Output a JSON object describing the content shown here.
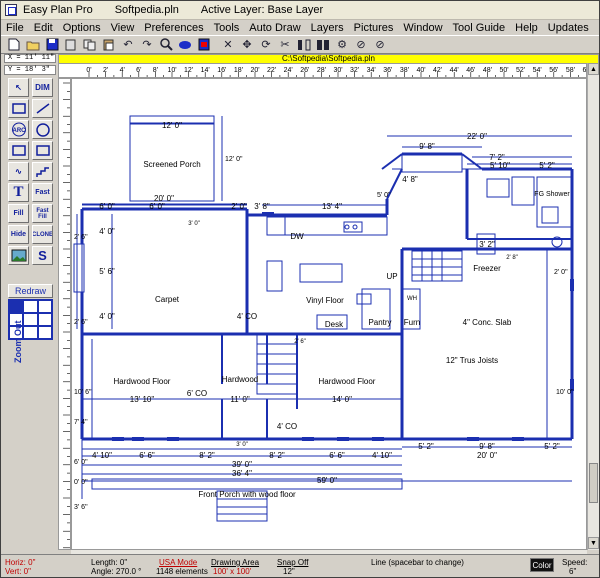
{
  "window": {
    "app": "Easy Plan Pro",
    "file": "Softpedia.pln",
    "active_layer": "Active Layer: Base Layer"
  },
  "menu": [
    "File",
    "Edit",
    "Options",
    "View",
    "Preferences",
    "Tools",
    "Auto Draw",
    "Layers",
    "Pictures",
    "Window",
    "Tool Guide",
    "Help",
    "Updates"
  ],
  "toolbar": {
    "icons": [
      "new-file-icon",
      "open-folder-icon",
      "save-icon",
      "print-preview-icon",
      "copy-icon",
      "paste-icon",
      "undo-icon",
      "redo-icon",
      "magnifier-icon",
      "toggle-icon",
      "color-fill-icon",
      "delete-icon",
      "move-icon",
      "rotate-icon",
      "cut-icon",
      "mirror-icon",
      "align-icon",
      "measure-icon",
      "check-icon",
      "no-icon"
    ]
  },
  "coords": {
    "x": "X = 11' 11\"",
    "y": "Y = 18' 3\""
  },
  "file_path": "C:\\Softpedia\\Softpedia.pln",
  "ruler_labels": [
    "0'",
    "2'",
    "4'",
    "6'",
    "8'",
    "10'",
    "12'",
    "14'",
    "16'",
    "18'",
    "20'",
    "22'",
    "24'",
    "26'",
    "28'",
    "30'",
    "32'",
    "34'",
    "36'",
    "38'",
    "40'",
    "42'",
    "44'",
    "46'",
    "48'",
    "50'",
    "52'",
    "54'",
    "56'",
    "58'",
    "60'"
  ],
  "palette": {
    "buttons": [
      {
        "name": "arrow-tool",
        "label": "↖"
      },
      {
        "name": "dim-tool",
        "label": "DIM"
      },
      {
        "name": "rect-tool",
        "label": ""
      },
      {
        "name": "line-tool",
        "label": ""
      },
      {
        "name": "arc-tool",
        "label": "ARC"
      },
      {
        "name": "circle-tool",
        "label": ""
      },
      {
        "name": "rectangle-tool",
        "label": ""
      },
      {
        "name": "box-tool",
        "label": ""
      },
      {
        "name": "curve-tool",
        "label": "∿"
      },
      {
        "name": "stair-tool",
        "label": ""
      },
      {
        "name": "text-tool",
        "label": "T"
      },
      {
        "name": "fast-text-tool",
        "label": "Fast"
      },
      {
        "name": "fill-tool",
        "label": "Fill"
      },
      {
        "name": "fast-fill-tool",
        "label": "Fast Fill"
      },
      {
        "name": "hide-tool",
        "label": "Hide"
      },
      {
        "name": "clone-tool",
        "label": "CLONE"
      },
      {
        "name": "picture-tool",
        "label": ""
      },
      {
        "name": "freehand-tool",
        "label": "S"
      }
    ],
    "redraw": "Redraw",
    "zoom_out": "Zoom Out"
  },
  "rooms": {
    "screened_porch": "Screened Porch",
    "carpet": "Carpet",
    "vinyl_floor": "Vinyl Floor",
    "dw": "DW",
    "desk": "Desk",
    "pantry": "Pantry",
    "furn": "Furn",
    "wh": "WH",
    "up": "UP",
    "freezer": "Freezer",
    "fg_shower": "FG Shower",
    "slab": "4\" Conc. Slab",
    "joists": "12\" Trus Joists",
    "hardwood1": "Hardwood Floor",
    "hardwood2": "Hardwood",
    "hardwood3": "Hardwood Floor",
    "co1": "4' CO",
    "co2": "6' CO",
    "co3": "4' CO",
    "front_porch": "Front Porch with wood floor"
  },
  "dims": {
    "d12top": "12' 0\"",
    "d12v": "12' 0\"",
    "d20": "20' 0\"",
    "d6a": "6' 0\"",
    "d6b": "6' 0\"",
    "d3_0": "3' 0\"",
    "d2_0": "2' 0\"",
    "d3_8": "3' 8\"",
    "d13_4": "13' 4\"",
    "d5_0": "5' 0\"",
    "d9_8": "9' 8\"",
    "d22": "22' 0\"",
    "d4_8": "4' 8\"",
    "d7_2": "7' 2\"",
    "d5_10": "5' 10\"",
    "d5_2a": "5' 2\"",
    "d3_2": "3' 2\"",
    "d2_8": "2' 8\"",
    "d2_6": "2' 6\"",
    "d5_6": "5' 6\"",
    "d4_0a": "4' 0\"",
    "d4_0b": "4' 0\"",
    "d2_6b": "2' 6\"",
    "d2_6c": "2' 6\"",
    "d13_10": "13' 10\"",
    "d11_0": "11' 0\"",
    "d14_0": "14' 0\"",
    "d10_0": "10' 0\"",
    "d5_2b": "5' 2\"",
    "d5_2c": "5' 2\"",
    "d9_8b": "9' 8\"",
    "d20b": "20' 0\"",
    "d4_10a": "4' 10\"",
    "d6_6a": "6' 6\"",
    "d8_2a": "8' 2\"",
    "d8_2b": "8' 2\"",
    "d6_6b": "6' 6\"",
    "d4_10b": "4' 10\"",
    "d39": "39' 0\"",
    "d36_4": "36' 4\"",
    "d59": "59' 0\"",
    "d7_4": "7' 4\"",
    "d10_6": "10' 6\"",
    "d6_0": "6' 0\"",
    "d3_0b": "3' 0\"",
    "d3_6": "3' 6\"",
    "d2_0b": "2' 0\"",
    "d0_0": "0' 0\""
  },
  "status": {
    "horiz": "Horiz: 0\"",
    "vert": "Vert: 0\"",
    "length": "Length:  0\"",
    "angle": "Angle: 270.0 °",
    "usa_mode": "USA Mode",
    "elements": "1148 elements",
    "drawing_area": "Drawing Area",
    "area_value": "100' x 100'",
    "snap": "Snap Off",
    "snap_value": "12\"",
    "hint": "Line (spacebar to change)",
    "color": "Color",
    "speed_label": "Speed:",
    "speed_value": "6\""
  }
}
